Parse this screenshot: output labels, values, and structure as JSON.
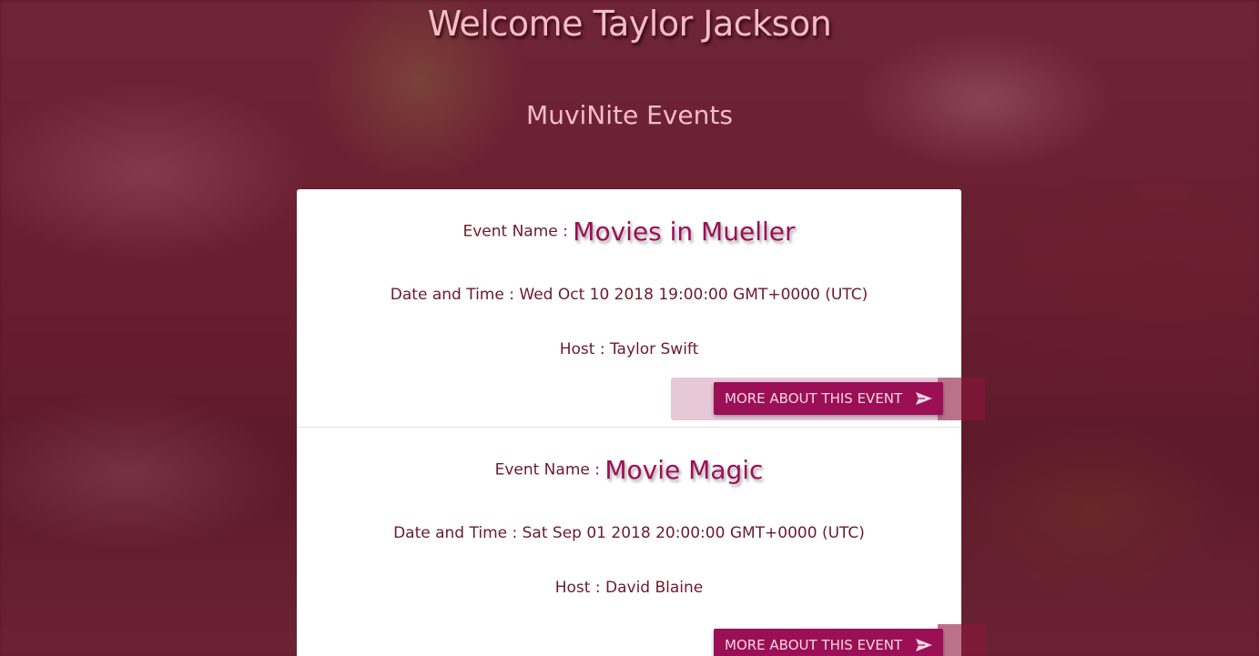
{
  "header": {
    "welcome": "Welcome Taylor Jackson",
    "section_title": "MuviNite Events"
  },
  "labels": {
    "event_name": "Event Name :",
    "date_time": "Date and Time :",
    "host": "Host :",
    "more_button": "MORE ABOUT THIS EVENT"
  },
  "events": [
    {
      "name": "Movies in Mueller",
      "date_time": "Wed Oct 10 2018 19:00:00 GMT+0000 (UTC)",
      "host": "Taylor Swift"
    },
    {
      "name": "Movie Magic",
      "date_time": "Sat Sep 01 2018 20:00:00 GMT+0000 (UTC)",
      "host": "David Blaine"
    }
  ],
  "icons": {
    "button_icon": "send-icon"
  },
  "colors": {
    "accent": "#9b0f56",
    "title_pink": "#f6bcc6",
    "text_maroon": "#6b1a2c"
  }
}
